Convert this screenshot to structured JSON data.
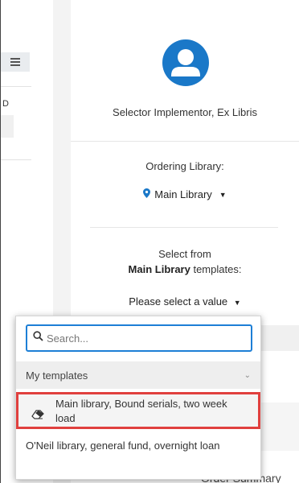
{
  "left": {
    "grid_icon": "list-view-icon",
    "truncated_text": "D"
  },
  "user": {
    "avatar_icon": "user-avatar-icon",
    "name": "Selector Implementor, Ex Libris"
  },
  "ordering": {
    "label": "Ordering Library:",
    "library_icon": "map-pin-icon",
    "library": "Main Library"
  },
  "templates": {
    "select_from": "Select from",
    "library_bold": "Main Library",
    "suffix": "templates:",
    "select_value": "Please select a value"
  },
  "dropdown": {
    "search_placeholder": "Search...",
    "group_label": "My templates",
    "items": [
      {
        "line1": "Main library, Bound serials, two week",
        "line2": "load",
        "icon": "eraser-icon",
        "selected": true
      },
      {
        "text": "O'Neil library, general fund, overnight loan",
        "selected": false
      }
    ]
  },
  "background": {
    "order_summary": "Order Summary"
  },
  "colors": {
    "accent": "#1a78c8",
    "search_border": "#1d7fd6",
    "highlight": "#e0403e"
  }
}
